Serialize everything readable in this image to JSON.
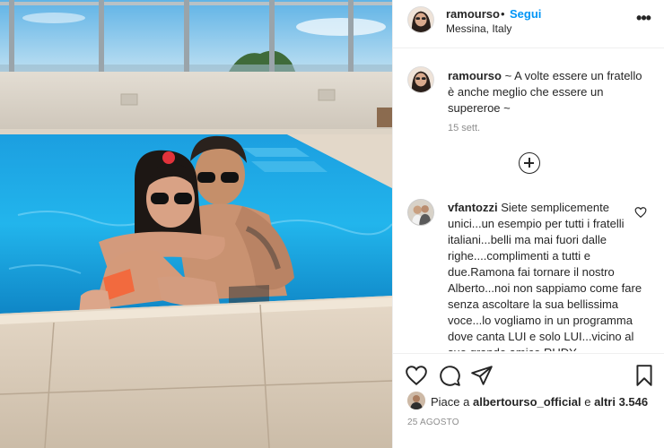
{
  "post": {
    "username": "ramourso",
    "separator": "•",
    "follow_label": "Segui",
    "location": "Messina, Italy",
    "more_label": "•••"
  },
  "caption": {
    "username": "ramourso",
    "text": "~ A volte essere un fratello è anche meglio che essere un supereroe ~",
    "time": "15 sett."
  },
  "comment": {
    "username": "vfantozzi",
    "text": "Siete semplicemente unici...un esempio per tutti i fratelli italiani...belli ma mai fuori dalle righe....complimenti a tutti e due.Ramona fai tornare il nostro Alberto...noi non sappiamo come fare senza ascoltare la sua bellissima voce...lo vogliamo in un programma dove canta LUI e solo LUI...vicino al suo grande amico RUDY"
  },
  "likes": {
    "prefix": "Piace a",
    "user": "albertourso_official",
    "middle": "e",
    "others": "altri 3.546"
  },
  "date": "25 AGOSTO",
  "icons": {
    "like": "heart-icon",
    "comment": "comment-bubble-icon",
    "share": "paper-plane-icon",
    "save": "bookmark-icon",
    "load_more": "plus-circle-icon"
  },
  "colors": {
    "follow": "#0095f6",
    "text": "#262626",
    "muted": "#8e8e8e",
    "pool": "#1aa3e0"
  }
}
